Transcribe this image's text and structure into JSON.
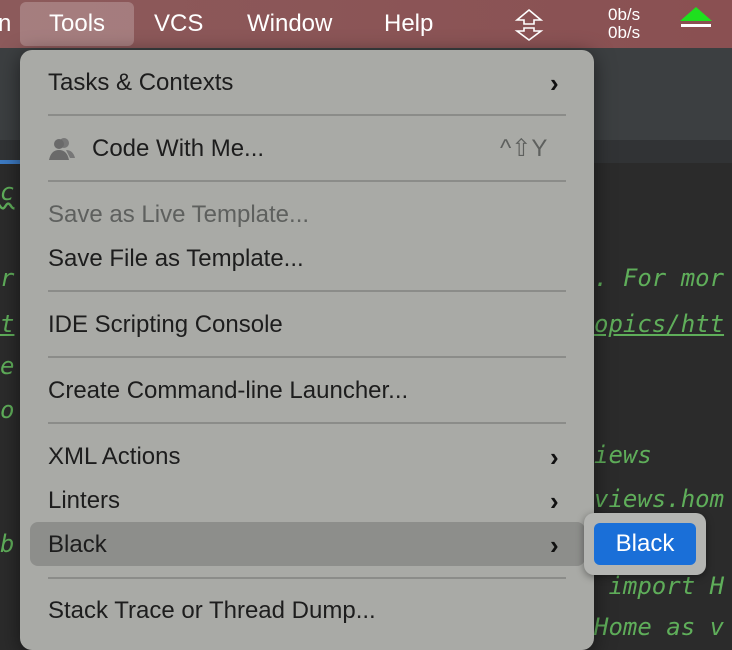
{
  "menubar": {
    "items": [
      "n",
      "Tools",
      "VCS",
      "Window",
      "Help"
    ],
    "net_up": "0b/s",
    "net_down": "0b/s",
    "active": "Tools"
  },
  "code": {
    "left": [
      "c",
      "r",
      "t",
      "e",
      "o",
      "b"
    ],
    "right": [
      ". For mor",
      "opics/htt",
      "iews",
      "views.hom",
      " import H",
      "Home as v"
    ]
  },
  "menu": {
    "tasks": "Tasks & Contexts",
    "code_with_me": "Code With Me...",
    "code_with_me_shortcut": "^⇧Y",
    "save_live": "Save as Live Template...",
    "save_file": "Save File as Template...",
    "ide_console": "IDE Scripting Console",
    "launcher": "Create Command-line Launcher...",
    "xml": "XML Actions",
    "linters": "Linters",
    "black": "Black",
    "stack": "Stack Trace or Thread Dump..."
  },
  "submenu": {
    "items": [
      "Black"
    ]
  },
  "colors": {
    "accent": "#1a6fd8",
    "menubar": "#8a5556",
    "code": "#5fae5a"
  }
}
